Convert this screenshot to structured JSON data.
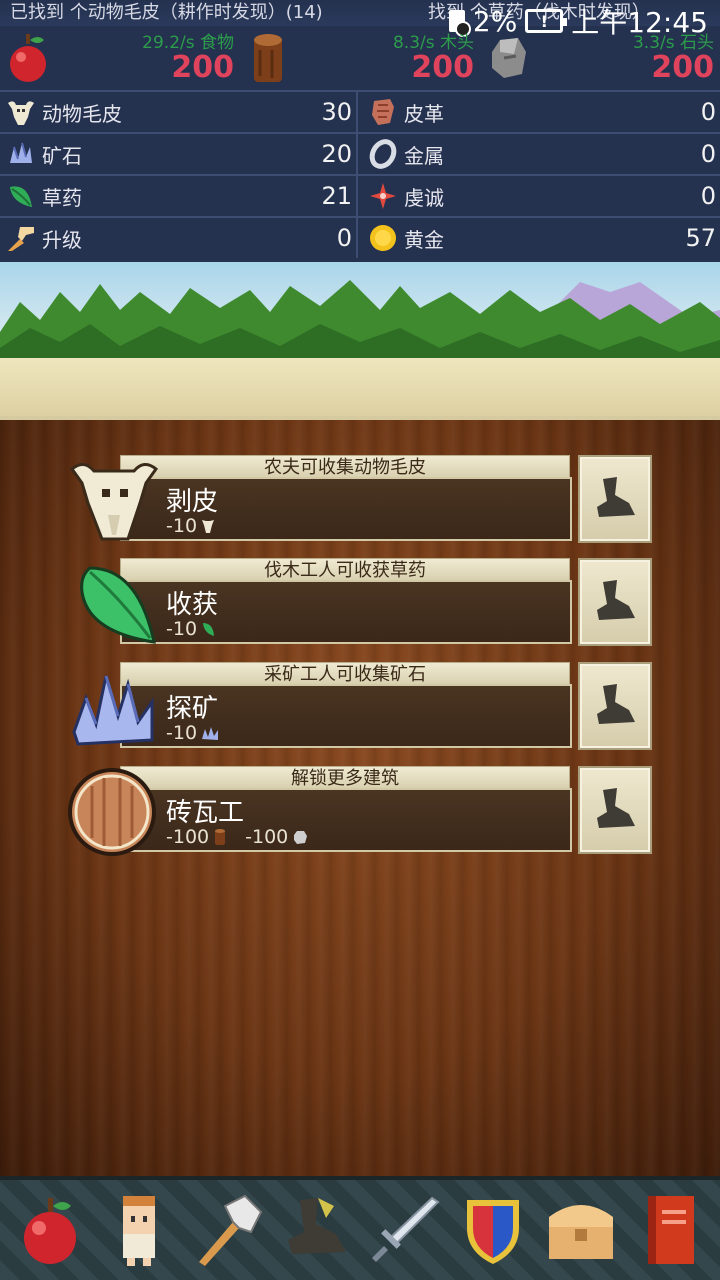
{
  "notification": {
    "text_left": "已找到 个动物毛皮（耕作时发现）(14)",
    "text_right": "找到 个草药（伐木时发现）"
  },
  "status_bar": {
    "battery": "2%",
    "time": "上午12:45"
  },
  "main_resources": [
    {
      "name": "食物",
      "rate": "29.2/s",
      "amount": "200",
      "icon": "apple-icon"
    },
    {
      "name": "木头",
      "rate": "8.3/s",
      "amount": "200",
      "icon": "log-icon"
    },
    {
      "name": "石头",
      "rate": "3.3/s",
      "amount": "200",
      "icon": "stone-icon"
    }
  ],
  "resources": [
    {
      "label": "动物毛皮",
      "value": "30",
      "icon": "skull-icon"
    },
    {
      "label": "皮革",
      "value": "0",
      "icon": "leather-icon"
    },
    {
      "label": "矿石",
      "value": "20",
      "icon": "ore-icon"
    },
    {
      "label": "金属",
      "value": "0",
      "icon": "ring-icon"
    },
    {
      "label": "草药",
      "value": "21",
      "icon": "leaf-icon"
    },
    {
      "label": "虔诚",
      "value": "0",
      "icon": "cross-icon"
    },
    {
      "label": "升级",
      "value": "0",
      "icon": "upgrade-icon"
    },
    {
      "label": "黄金",
      "value": "57",
      "icon": "gold-coin-icon"
    }
  ],
  "actions": [
    {
      "header": "农夫可收集动物毛皮",
      "title": "剥皮",
      "cost": "-10",
      "cost_icon": "skull-icon"
    },
    {
      "header": "伐木工人可收获草药",
      "title": "收获",
      "cost": "-10",
      "cost_icon": "leaf-icon"
    },
    {
      "header": "采矿工人可收集矿石",
      "title": "探矿",
      "cost": "-10",
      "cost_icon": "ore-icon"
    },
    {
      "header": "解锁更多建筑",
      "title": "砖瓦工",
      "cost": "-100",
      "cost2": "-100",
      "cost_icon": "log-icon",
      "cost2_icon": "stone-icon"
    }
  ],
  "nav_tabs": [
    "apple-tab-icon",
    "villager-tab-icon",
    "hammer-tab-icon",
    "boot-tab-icon",
    "sword-tab-icon",
    "shield-tab-icon",
    "chest-tab-icon",
    "book-tab-icon"
  ],
  "colors": {
    "rate_green": "#2c9d4b",
    "amount_red": "#e0435c",
    "panel_blue": "#24314f"
  }
}
